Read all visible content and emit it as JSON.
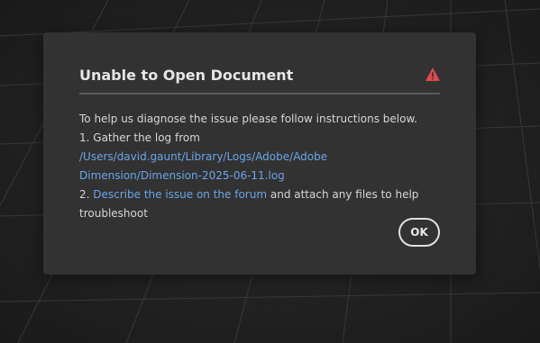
{
  "dialog": {
    "title": "Unable to Open Document",
    "alert_icon": "alert-triangle-icon",
    "alert_color": "#e34850",
    "intro": "To help us diagnose the issue please follow instructions below.",
    "step1_prefix": "1. Gather the log from ",
    "step1_link": "/Users/david.gaunt/Library/Logs/Adobe/Adobe Dimension/Dimension-2025-06-11.log",
    "step2_prefix": "2. ",
    "step2_link": "Describe the issue on the forum",
    "step2_suffix": " and attach any files to help troubleshoot",
    "ok_label": "OK"
  },
  "colors": {
    "dialog_bg": "#323232",
    "text": "#d6d6d6",
    "link": "#6aa5e8",
    "backdrop": "#1f1f1f"
  }
}
